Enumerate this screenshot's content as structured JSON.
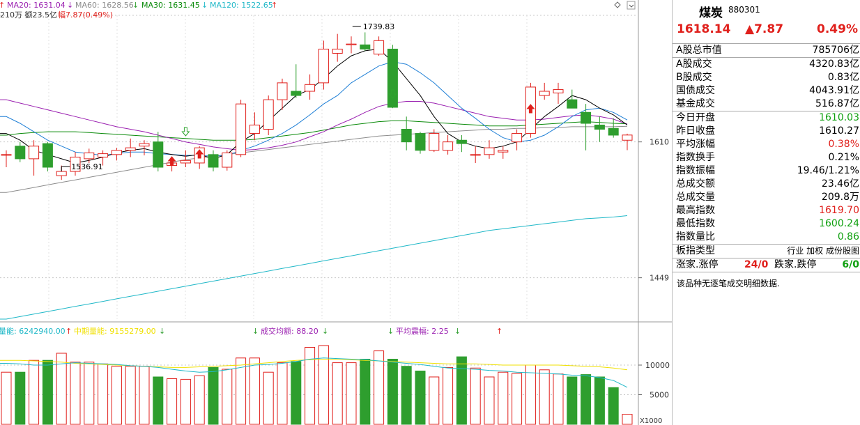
{
  "ma_header": {
    "ma20": "MA20: 1631.04",
    "ma60": "MA60: 1628.56",
    "ma30": "MA30: 1631.45",
    "ma120": "MA120: 1522.65",
    "line2": "210万 额23.5亿",
    "line2b": "幅7.87(0.49%)"
  },
  "price_labels": {
    "high": "1739.83",
    "low": "1536.91",
    "p1610": "1610",
    "p1449": "1449"
  },
  "vol_header": {
    "vol": "量能: 6242940.00",
    "mid": "中期量能: 9155279.00",
    "avg": "成交均额: 88.20",
    "amp": "平均震幅: 2.25"
  },
  "vol_labels": {
    "v10000": "10000",
    "v5000": "5000",
    "unit": "X1000"
  },
  "colors": {
    "up": "#e0201c",
    "down": "#2e9e2e",
    "ma5": "#000000",
    "ma10": "#1e7fd6",
    "ma20": "#9a1fb0",
    "ma30": "#0a8a0a",
    "ma60": "#8c8c8c",
    "ma120": "#20b8c8",
    "vol_ma": "#f0e000",
    "grid": "#c8c8c8"
  },
  "panel": {
    "name": "煤炭",
    "code": "880301",
    "price": "1618.14",
    "change": "▲7.87",
    "pct": "0.49%",
    "rows": [
      {
        "k": "A股总市值",
        "v": "785706亿",
        "c": "blk"
      },
      {
        "k": "A股成交",
        "v": "4320.83亿",
        "c": "blk"
      },
      {
        "k": "B股成交",
        "v": "0.83亿",
        "c": "blk"
      },
      {
        "k": "国债成交",
        "v": "4043.91亿",
        "c": "blk"
      },
      {
        "k": "基金成交",
        "v": "516.87亿",
        "c": "blk"
      },
      {
        "k": "今日开盘",
        "v": "1610.03",
        "c": "green"
      },
      {
        "k": "昨日收盘",
        "v": "1610.27",
        "c": "blk"
      },
      {
        "k": "平均涨幅",
        "v": "0.38%",
        "c": "red"
      },
      {
        "k": "指数换手",
        "v": "0.21%",
        "c": "blk"
      },
      {
        "k": "指数振幅",
        "v": "19.46/1.21%",
        "c": "blk"
      },
      {
        "k": "总成交额",
        "v": "23.46亿",
        "c": "blk"
      },
      {
        "k": "总成交量",
        "v": "209.8万",
        "c": "blk"
      },
      {
        "k": "最高指数",
        "v": "1619.70",
        "c": "red"
      },
      {
        "k": "最低指数",
        "v": "1600.24",
        "c": "green"
      },
      {
        "k": "指数量比",
        "v": "0.86",
        "c": "green"
      },
      {
        "k": "板指类型",
        "v": "行业 加权 成份股图",
        "c": "blk"
      }
    ],
    "updown_label": "涨家.涨停",
    "updown_val": "24/0",
    "down_label": "跌家.跌停",
    "down_val": "6/0",
    "note": "该品种无逐笔成交明细数据."
  },
  "chart_data": {
    "type": "candlestick",
    "ylim": [
      1400,
      1760
    ],
    "candles": [
      [
        1595,
        1600,
        1580,
        1595
      ],
      [
        1605,
        1610,
        1586,
        1590
      ],
      [
        1590,
        1612,
        1570,
        1605
      ],
      [
        1608,
        1610,
        1575,
        1580
      ],
      [
        1570,
        1582,
        1565,
        1575
      ],
      [
        1575,
        1598,
        1570,
        1592
      ],
      [
        1590,
        1602,
        1585,
        1597
      ],
      [
        1592,
        1600,
        1582,
        1596
      ],
      [
        1595,
        1603,
        1588,
        1600
      ],
      [
        1600,
        1614,
        1592,
        1603
      ],
      [
        1605,
        1612,
        1594,
        1608
      ],
      [
        1610,
        1622,
        1575,
        1580
      ],
      [
        1582,
        1590,
        1575,
        1585
      ],
      [
        1585,
        1600,
        1580,
        1588
      ],
      [
        1585,
        1605,
        1578,
        1603
      ],
      [
        1595,
        1600,
        1575,
        1580
      ],
      [
        1580,
        1600,
        1576,
        1597
      ],
      [
        1595,
        1660,
        1592,
        1655
      ],
      [
        1620,
        1645,
        1612,
        1630
      ],
      [
        1625,
        1665,
        1618,
        1660
      ],
      [
        1660,
        1685,
        1648,
        1680
      ],
      [
        1670,
        1702,
        1662,
        1665
      ],
      [
        1670,
        1690,
        1660,
        1678
      ],
      [
        1680,
        1730,
        1672,
        1720
      ],
      [
        1715,
        1738,
        1705,
        1720
      ],
      [
        1725,
        1735,
        1715,
        1726
      ],
      [
        1725,
        1739.83,
        1718,
        1720
      ],
      [
        1714,
        1735,
        1712,
        1730
      ],
      [
        1720,
        1725,
        1650,
        1651
      ],
      [
        1625,
        1640,
        1600,
        1610
      ],
      [
        1620,
        1622,
        1596,
        1600
      ],
      [
        1600,
        1625,
        1598,
        1620
      ],
      [
        1600,
        1618,
        1595,
        1610
      ],
      [
        1612,
        1618,
        1598,
        1608
      ],
      [
        1595,
        1605,
        1585,
        1595
      ],
      [
        1595,
        1612,
        1590,
        1603
      ],
      [
        1598,
        1605,
        1590,
        1600
      ],
      [
        1610,
        1625,
        1600,
        1620
      ],
      [
        1620,
        1680,
        1615,
        1675
      ],
      [
        1665,
        1680,
        1660,
        1670
      ],
      [
        1668,
        1680,
        1655,
        1672
      ],
      [
        1660,
        1672,
        1650,
        1650
      ],
      [
        1645,
        1655,
        1600,
        1632
      ],
      [
        1630,
        1640,
        1610,
        1625
      ],
      [
        1626,
        1638,
        1615,
        1618
      ],
      [
        1612,
        1619.7,
        1600.24,
        1618.14
      ]
    ],
    "ma5": [
      1620,
      1612,
      1600,
      1595,
      1590,
      1585,
      1588,
      1592,
      1597,
      1600,
      1602,
      1598,
      1595,
      1593,
      1595,
      1590,
      1595,
      1610,
      1620,
      1635,
      1650,
      1665,
      1672,
      1685,
      1700,
      1712,
      1718,
      1720,
      1705,
      1685,
      1665,
      1640,
      1620,
      1610,
      1605,
      1602,
      1605,
      1610,
      1625,
      1640,
      1652,
      1665,
      1660,
      1650,
      1642,
      1630
    ],
    "ma10": [
      1640,
      1632,
      1622,
      1612,
      1605,
      1598,
      1596,
      1594,
      1596,
      1598,
      1598,
      1596,
      1595,
      1594,
      1594,
      1593,
      1594,
      1600,
      1605,
      1612,
      1620,
      1630,
      1642,
      1655,
      1665,
      1680,
      1690,
      1700,
      1705,
      1702,
      1692,
      1680,
      1665,
      1650,
      1638,
      1625,
      1615,
      1610,
      1612,
      1618,
      1628,
      1640,
      1648,
      1650,
      1645,
      1636
    ],
    "ma20": [
      1660,
      1656,
      1652,
      1648,
      1644,
      1640,
      1636,
      1632,
      1628,
      1625,
      1622,
      1618,
      1614,
      1610,
      1607,
      1604,
      1602,
      1600,
      1601,
      1603,
      1606,
      1610,
      1616,
      1622,
      1630,
      1637,
      1645,
      1652,
      1656,
      1658,
      1658,
      1656,
      1652,
      1648,
      1644,
      1640,
      1638,
      1636,
      1636,
      1637,
      1639,
      1641,
      1642,
      1640,
      1637,
      1631.04
    ],
    "ma30": [
      1618,
      1620,
      1621,
      1622,
      1622,
      1622,
      1621,
      1620,
      1619,
      1618,
      1617,
      1616,
      1615,
      1614,
      1613,
      1612,
      1612,
      1612,
      1613,
      1615,
      1617,
      1619,
      1621,
      1624,
      1627,
      1630,
      1632,
      1634,
      1635,
      1635,
      1634,
      1633,
      1632,
      1631,
      1630,
      1629,
      1629,
      1629,
      1630,
      1631,
      1632,
      1633,
      1634,
      1633,
      1632,
      1631.45
    ],
    "ma60": [
      1550,
      1553,
      1556,
      1559,
      1562,
      1565,
      1568,
      1571,
      1574,
      1577,
      1580,
      1583,
      1586,
      1589,
      1591,
      1593,
      1595,
      1597,
      1599,
      1601,
      1603,
      1605,
      1607,
      1609,
      1611,
      1613,
      1615,
      1617,
      1618,
      1619,
      1620,
      1621,
      1622,
      1623,
      1624,
      1625,
      1625,
      1626,
      1626,
      1627,
      1627,
      1628,
      1628,
      1628,
      1628,
      1628.56
    ],
    "ma120": [
      1400,
      1403,
      1406,
      1409,
      1412,
      1415,
      1418,
      1421,
      1424,
      1427,
      1430,
      1433,
      1436,
      1439,
      1442,
      1445,
      1448,
      1451,
      1454,
      1457,
      1460,
      1463,
      1466,
      1469,
      1472,
      1475,
      1478,
      1481,
      1484,
      1487,
      1490,
      1493,
      1496,
      1499,
      1502,
      1505,
      1507,
      1509,
      1511,
      1513,
      1515,
      1517,
      1519,
      1520,
      1521,
      1522.65
    ],
    "volume": [
      8800,
      8800,
      10800,
      10800,
      12000,
      10500,
      10500,
      10200,
      9800,
      9800,
      9800,
      8000,
      7700,
      7600,
      8200,
      9600,
      9300,
      11200,
      11200,
      8800,
      10400,
      10600,
      13000,
      13300,
      10400,
      10400,
      11000,
      12400,
      11000,
      9800,
      9000,
      8000,
      9600,
      11400,
      9500,
      8000,
      8800,
      8600,
      10000,
      9200,
      8500,
      8000,
      8400,
      8000,
      6200,
      1700
    ],
    "vol_ma_yellow": [
      10800,
      10800,
      10700,
      10600,
      10500,
      10300,
      10200,
      10100,
      10000,
      9900,
      9800,
      9700,
      9600,
      9600,
      9700,
      9800,
      9900,
      10000,
      10200,
      10400,
      10600,
      10800,
      10900,
      11000,
      11000,
      10900,
      10800,
      10700,
      10600,
      10500,
      10400,
      10300,
      10200,
      10200,
      10200,
      10100,
      10000,
      10000,
      10000,
      10000,
      10000,
      9900,
      9800,
      9700,
      9500,
      9200
    ],
    "vol_ma_cyan": [
      10300,
      10200,
      10000,
      10000,
      10200,
      10400,
      10300,
      10200,
      10100,
      9900,
      9800,
      9600,
      9300,
      9000,
      8800,
      8900,
      9200,
      9600,
      10000,
      10100,
      10300,
      10600,
      11000,
      11200,
      11100,
      11000,
      10900,
      10700,
      10500,
      10300,
      10100,
      9800,
      9500,
      9400,
      9300,
      9100,
      9000,
      8800,
      8700,
      8600,
      8500,
      8300,
      8200,
      7900,
      7400,
      6242.94
    ],
    "vol_ylim": [
      0,
      14000
    ]
  }
}
